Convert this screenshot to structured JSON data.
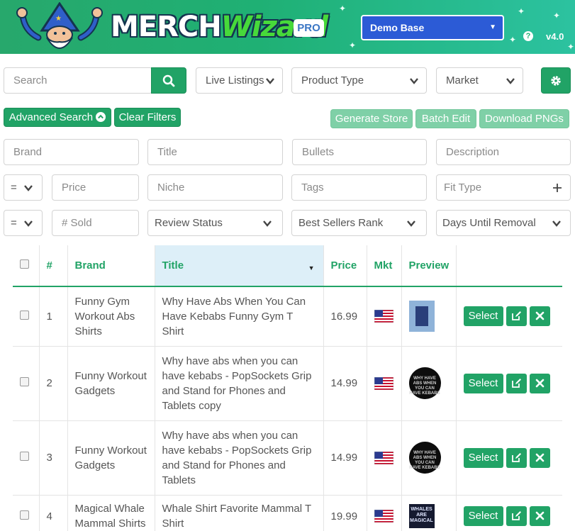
{
  "header": {
    "logo_merch": "MERCH",
    "logo_wizard": "Wizard",
    "pro_badge": "PRO",
    "base_selector": "Demo Base",
    "version": "v4.0",
    "help_label": "?"
  },
  "toolbar": {
    "search_placeholder": "Search",
    "listings_filter": "Live Listings",
    "product_type": "Product Type",
    "market": "Market"
  },
  "actions": {
    "advanced_search": "Advanced Search",
    "clear_filters": "Clear Filters",
    "generate_store": "Generate Store",
    "batch_edit": "Batch Edit",
    "download_pngs": "Download PNGs"
  },
  "filters": {
    "brand_placeholder": "Brand",
    "title_placeholder": "Title",
    "bullets_placeholder": "Bullets",
    "description_placeholder": "Description",
    "price_operator": "=",
    "price_placeholder": "Price",
    "niche_placeholder": "Niche",
    "tags_placeholder": "Tags",
    "fit_type": "Fit Type",
    "sold_operator": "=",
    "sold_placeholder": "# Sold",
    "review_status": "Review Status",
    "best_sellers_rank": "Best Sellers Rank",
    "days_until_removal": "Days Until Removal"
  },
  "table": {
    "headers": {
      "index": "#",
      "brand": "Brand",
      "title": "Title",
      "price": "Price",
      "market": "Mkt",
      "preview": "Preview"
    },
    "select_label": "Select",
    "rows": [
      {
        "index": "1",
        "brand": "Funny Gym Workout Abs Shirts",
        "title": "Why Have Abs When You Can Have Kebabs Funny Gym T Shirt",
        "price": "16.99",
        "preview_text": ""
      },
      {
        "index": "2",
        "brand": "Funny Workout Gadgets",
        "title": "Why have abs when you can have kebabs - PopSockets Grip and Stand for Phones and Tablets copy",
        "price": "14.99",
        "preview_text": "WHY HAVE ABS WHEN YOU CAN HAVE KEBABS"
      },
      {
        "index": "3",
        "brand": "Funny Workout Gadgets",
        "title": "Why have abs when you can have kebabs - PopSockets Grip and Stand for Phones and Tablets",
        "price": "14.99",
        "preview_text": "WHY HAVE ABS WHEN YOU CAN HAVE KEBABS"
      },
      {
        "index": "4",
        "brand": "Magical Whale Mammal Shirts",
        "title": "Whale Shirt Favorite Mammal T Shirt",
        "price": "19.99",
        "preview_text": "WHALES ARE MAGICAL"
      }
    ]
  },
  "colors": {
    "brand_green": "#21a366",
    "light_green": "#7fd0a7",
    "selector_blue": "#2c5bd6",
    "sorted_header_bg": "#ddeff8"
  }
}
